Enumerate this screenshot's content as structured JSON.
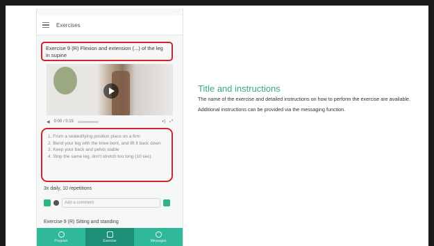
{
  "phone": {
    "app_title": "Exercises",
    "exercise_title": "Exercise 9 (R) Flexion and extension (...) of the leg in supine",
    "video_time": "0:00 / 0:15",
    "instructions": [
      "1. From a seated/lying position place on a firm",
      "2. Bend your leg with the knee bent, and lift it back down",
      "3. Keep your back and pelvis stable",
      "4. Stop the same leg, don't stretch too long (10 sec)"
    ],
    "repetitions": "3x daily, 10 repetitions",
    "comment_placeholder": "Add a comment",
    "next_exercise": "Exercise 9 (R) Sitting and standing",
    "nav": [
      "Program",
      "Exercise",
      "Messages"
    ]
  },
  "heading": "Title and instructions",
  "paragraph1": "The name of the exercise and detailed instructions on how to perform the exercise are available.",
  "paragraph2": "Additional instructions can be provided via the messaging function.",
  "colors": {
    "accent": "#37a68c",
    "highlight": "#d81e2a",
    "nav_bg": "#2fb99a"
  }
}
